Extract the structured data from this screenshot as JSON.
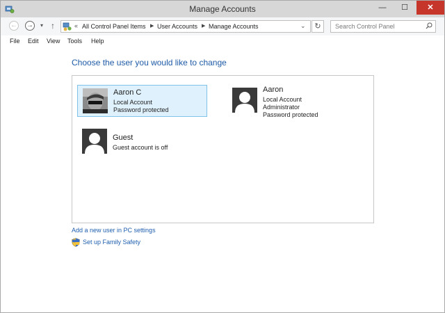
{
  "window": {
    "title": "Manage Accounts",
    "minimize_glyph": "—",
    "maximize_glyph": "☐",
    "close_glyph": "✕"
  },
  "nav": {
    "back_glyph": "←",
    "forward_glyph": "→",
    "dropdown_glyph": "▾",
    "up_glyph": "↑",
    "more_glyph": "«",
    "breadcrumbs": [
      "All Control Panel Items",
      "User Accounts",
      "Manage Accounts"
    ],
    "separator_glyph": "▶",
    "address_dropdown_glyph": "⌄",
    "refresh_glyph": "↻",
    "search_placeholder": "Search Control Panel"
  },
  "menu": [
    "File",
    "Edit",
    "View",
    "Tools",
    "Help"
  ],
  "main": {
    "heading": "Choose the user you would like to change",
    "accounts": [
      {
        "name": "Aaron C",
        "lines": [
          "Local Account",
          "Password protected"
        ],
        "selected": true,
        "avatar": "photo"
      },
      {
        "name": "Aaron",
        "lines": [
          "Local Account",
          "Administrator",
          "Password protected"
        ],
        "selected": false,
        "avatar": "default-user"
      },
      {
        "name": "Guest",
        "lines": [
          "Guest account is off"
        ],
        "selected": false,
        "avatar": "default-user"
      }
    ]
  },
  "links": {
    "add_user": "Add a new user in PC settings",
    "family_safety": "Set up Family Safety"
  },
  "colors": {
    "heading": "#1e5aa8",
    "link": "#1f5fb0",
    "selection_fill": "#dff1fc",
    "selection_border": "#7fc3ea",
    "close_button": "#c7362b"
  }
}
